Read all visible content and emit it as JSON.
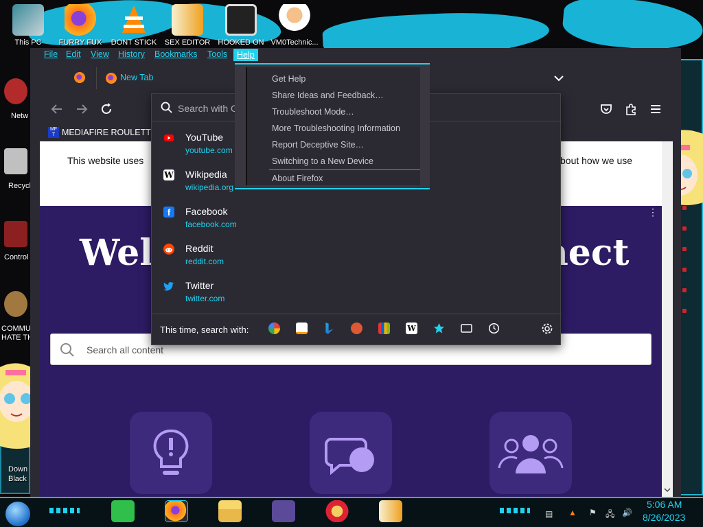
{
  "desktop": {
    "top_icons": [
      {
        "label": "This PC"
      },
      {
        "label": "FURRY FUX"
      },
      {
        "label": "DONT STICK"
      },
      {
        "label": "SEX EDITOR"
      },
      {
        "label": "HOOKED ON"
      },
      {
        "label": "VM0Technic..."
      }
    ],
    "side_labels": [
      "Netw",
      "Recycl",
      "Control",
      "COMMU",
      "HATE TH",
      "Down",
      "Black"
    ]
  },
  "firefox": {
    "menubar": [
      "File",
      "Edit",
      "View",
      "History",
      "Bookmarks",
      "Tools",
      "Help"
    ],
    "tab": {
      "label": "New Tab"
    },
    "bookmark": {
      "label": "MEDIAFIRE ROULETTER",
      "icon_text": "MF T"
    },
    "search": {
      "placeholder": "Search with G"
    },
    "page": {
      "cookie_text_left": "This website uses",
      "cookie_text_right": "bout how we use",
      "hero_left": "Welc",
      "hero_right": "nect",
      "search_placeholder": "Search all content"
    },
    "suggestions": [
      {
        "title": "YouTube",
        "url": "youtube.com",
        "icon": "youtube-icon",
        "color": "#ff0000"
      },
      {
        "title": "Wikipedia",
        "url": "wikipedia.org",
        "icon": "wikipedia-icon",
        "color": "#ffffff"
      },
      {
        "title": "Facebook",
        "url": "facebook.com",
        "icon": "facebook-icon",
        "color": "#1877f2"
      },
      {
        "title": "Reddit",
        "url": "reddit.com",
        "icon": "reddit-icon",
        "color": "#ff4500"
      },
      {
        "title": "Twitter",
        "url": "twitter.com",
        "icon": "twitter-icon",
        "color": "#1da1f2"
      }
    ],
    "search_with_label": "This time, search with:",
    "engines": [
      "google-icon",
      "amazon-icon",
      "bing-icon",
      "duckduckgo-icon",
      "ebay-icon",
      "wikipedia-icon",
      "bookmarks-star-icon",
      "tabs-icon",
      "history-icon"
    ],
    "help_menu": {
      "items": [
        "Get Help",
        "Share Ideas and Feedback…",
        "Troubleshoot Mode…",
        "More Troubleshooting Information",
        "Report Deceptive Site…",
        "Switching to a New Device",
        "About Firefox"
      ]
    }
  },
  "taskbar": {
    "time": "5:06 AM",
    "date": "8/26/2023"
  },
  "colors": {
    "accent": "#1fd3ef",
    "firefox_bg": "#2b2a33",
    "page_purple": "#2d1b64"
  }
}
